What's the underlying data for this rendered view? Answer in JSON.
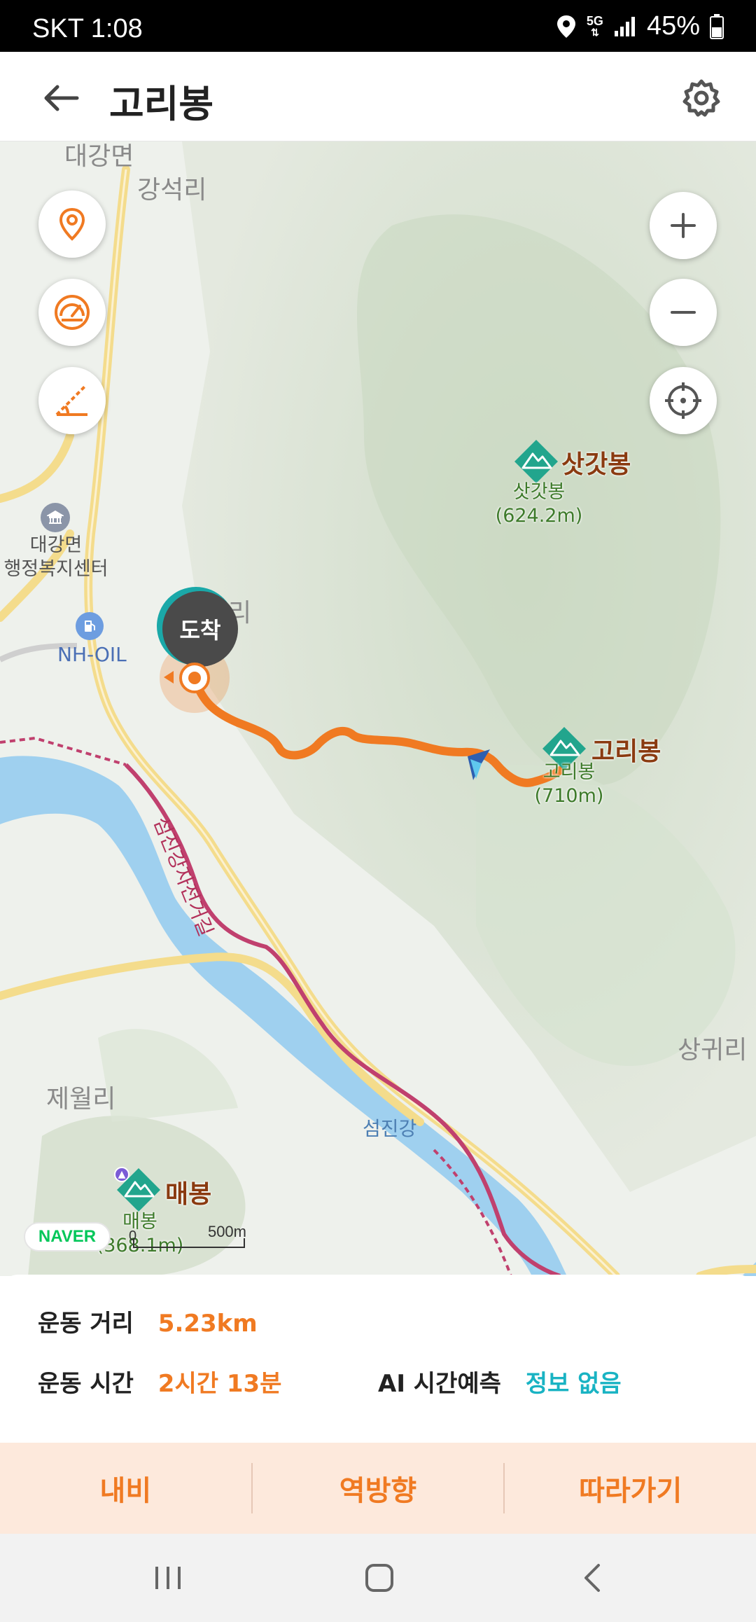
{
  "status_bar": {
    "carrier": "SKT",
    "time": "1:08",
    "network": "5G",
    "battery": "45%"
  },
  "header": {
    "title": "고리봉"
  },
  "map": {
    "labels": {
      "daegang_myeon": "대강면",
      "gangseok_ri": "강석리",
      "office": "대강면\n행정복지센터",
      "ri_partial": "리",
      "nh_oil": "NH-OIL",
      "jewol_ri": "제월리",
      "sanggwi_ri": "상귀리",
      "seomjin_river": "섬진강",
      "bike_path": "섬진강자전거길"
    },
    "peaks": {
      "satgatbong": {
        "name": "삿갓봉",
        "sub_name": "삿갓봉",
        "elevation": "(624.2m)"
      },
      "goribong": {
        "name": "고리봉",
        "sub_name": "고리봉",
        "elevation": "(710m)"
      },
      "maebong": {
        "name": "매봉",
        "sub_name": "매봉",
        "elevation": "(368.1m)"
      }
    },
    "arrive_label": "도착",
    "brand": "NAVER",
    "scale_zero": "0",
    "scale_label": "500m"
  },
  "stats": {
    "distance_label": "운동 거리",
    "distance_value": "5.23km",
    "time_label": "운동 시간",
    "time_value": "2시간 13분",
    "ai_label": "AI 시간예측",
    "ai_value": "정보 없음"
  },
  "actions": {
    "navi": "내비",
    "reverse": "역방향",
    "follow": "따라가기"
  },
  "colors": {
    "accent": "#f07a22",
    "teal": "#19b3c3",
    "action_bg": "#fde9dc"
  }
}
